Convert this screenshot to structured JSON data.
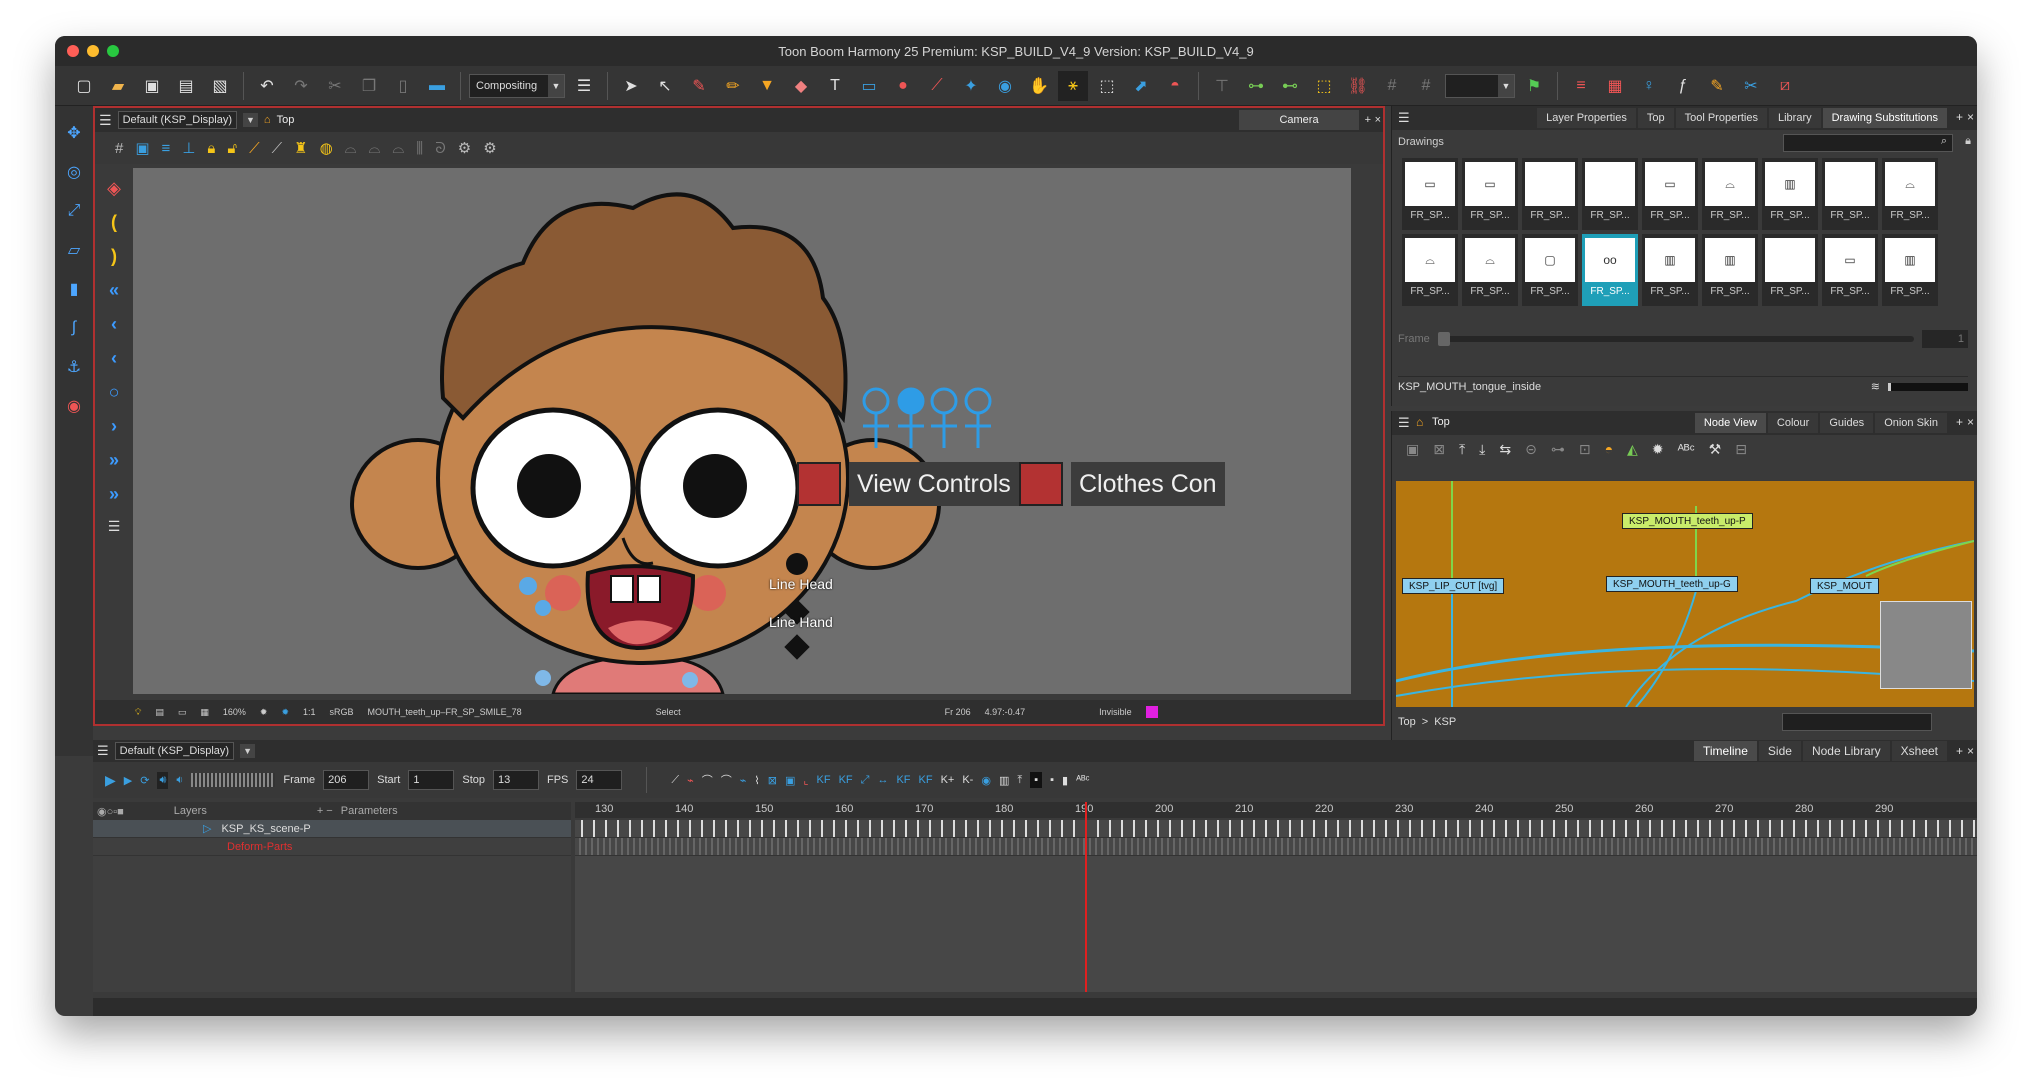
{
  "window": {
    "title": "Toon Boom Harmony 25 Premium: KSP_BUILD_V4_9 Version: KSP_BUILD_V4_9"
  },
  "toolbar": {
    "workspace": "Compositing"
  },
  "camera_panel": {
    "view_select": "Default (KSP_Display)",
    "view_label": "Top",
    "tab": "Camera",
    "control_buttons": [
      "View Controls",
      "Clothes Con"
    ],
    "line_labels": [
      "Line Head",
      "Line Hand"
    ],
    "status": {
      "zoom": "160%",
      "ratio": "1:1",
      "colorspace": "sRGB",
      "drawing": "MOUTH_teeth_up–FR_SP_SMILE_78",
      "tool": "Select",
      "frame": "Fr 206",
      "coords": "4.97:-0.47",
      "mode": "Invisible"
    }
  },
  "drawings_panel": {
    "tabs": [
      "Layer Properties",
      "Top",
      "Tool Properties",
      "Library",
      "Drawing Substitutions"
    ],
    "active_tab": "Drawing Substitutions",
    "section": "Drawings",
    "cells": [
      "FR_SP...",
      "FR_SP...",
      "FR_SP...",
      "FR_SP...",
      "FR_SP...",
      "FR_SP...",
      "FR_SP...",
      "FR_SP...",
      "FR_SP...",
      "FR_SP...",
      "FR_SP...",
      "FR_SP...",
      "FR_SP...",
      "FR_SP...",
      "FR_SP...",
      "FR_SP...",
      "FR_SP...",
      "FR_SP..."
    ],
    "frame_label": "Frame",
    "frame_value": "1",
    "footer": "KSP_MOUTH_tongue_inside"
  },
  "node_panel": {
    "view_label": "Top",
    "tabs": [
      "Node View",
      "Colour",
      "Guides",
      "Onion Skin"
    ],
    "nodes": [
      "KSP_MOUTH_teeth_up-P",
      "KSP_LIP_CUT [tvg]",
      "KSP_MOUTH_teeth_up-G",
      "KSP_MOUT"
    ],
    "breadcrumb": [
      "Top",
      ">",
      "KSP"
    ]
  },
  "timeline": {
    "view_select": "Default (KSP_Display)",
    "tabs": [
      "Timeline",
      "Side",
      "Node Library",
      "Xsheet"
    ],
    "frame_label": "Frame",
    "frame": "206",
    "start_label": "Start",
    "start": "1",
    "stop_label": "Stop",
    "stop": "13",
    "fps_label": "FPS",
    "fps": "24",
    "layers_label": "Layers",
    "params_label": "Parameters",
    "layers": [
      "KSP_KS_scene-P",
      "Deform-Parts"
    ],
    "ruler": [
      "130",
      "140",
      "150",
      "160",
      "170",
      "180",
      "190",
      "200",
      "210",
      "220",
      "230",
      "240",
      "250",
      "260",
      "270",
      "280",
      "290"
    ]
  }
}
